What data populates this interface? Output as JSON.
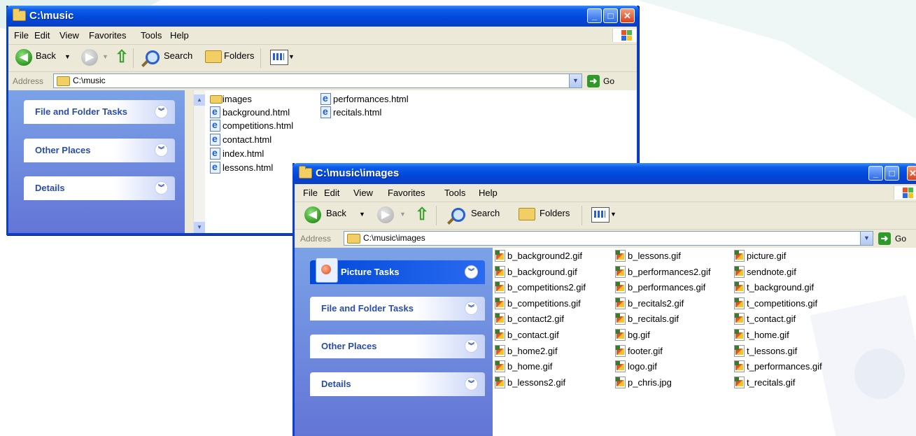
{
  "win1": {
    "title": "C:\\music",
    "menu": [
      "File",
      "Edit",
      "View",
      "Favorites",
      "Tools",
      "Help"
    ],
    "toolbar": {
      "back": "Back",
      "search": "Search",
      "folders": "Folders"
    },
    "address": {
      "label": "Address",
      "value": "C:\\music",
      "go": "Go"
    },
    "tasks": [
      "File and Folder Tasks",
      "Other Places",
      "Details"
    ],
    "files": [
      {
        "name": "images",
        "type": "folder"
      },
      {
        "name": "background.html",
        "type": "html"
      },
      {
        "name": "competitions.html",
        "type": "html"
      },
      {
        "name": "contact.html",
        "type": "html"
      },
      {
        "name": "index.html",
        "type": "html"
      },
      {
        "name": "lessons.html",
        "type": "html"
      },
      {
        "name": "performances.html",
        "type": "html"
      },
      {
        "name": "recitals.html",
        "type": "html"
      }
    ]
  },
  "win2": {
    "title": "C:\\music\\images",
    "menu": [
      "File",
      "Edit",
      "View",
      "Favorites",
      "Tools",
      "Help"
    ],
    "toolbar": {
      "back": "Back",
      "search": "Search",
      "folders": "Folders"
    },
    "address": {
      "label": "Address",
      "value": "C:\\music\\images",
      "go": "Go"
    },
    "tasks": [
      "Picture Tasks",
      "File and Folder Tasks",
      "Other Places",
      "Details"
    ],
    "files": [
      "b_background2.gif",
      "b_background.gif",
      "b_competitions2.gif",
      "b_competitions.gif",
      "b_contact2.gif",
      "b_contact.gif",
      "b_home2.gif",
      "b_home.gif",
      "b_lessons2.gif",
      "b_lessons.gif",
      "b_performances2.gif",
      "b_performances.gif",
      "b_recitals2.gif",
      "b_recitals.gif",
      "bg.gif",
      "footer.gif",
      "logo.gif",
      "p_chris.jpg",
      "picture.gif",
      "sendnote.gif",
      "t_background.gif",
      "t_competitions.gif",
      "t_contact.gif",
      "t_home.gif",
      "t_lessons.gif",
      "t_performances.gif",
      "t_recitals.gif"
    ]
  },
  "colors": {
    "titlebar": "#0a5be6",
    "taskpane": "#6f8fe0",
    "chrome": "#ece9d8"
  },
  "icons": [
    "folder-icon",
    "back-icon",
    "forward-icon",
    "up-icon",
    "search-icon",
    "folders-icon",
    "views-icon",
    "go-icon",
    "chevron-icon",
    "html-file-icon",
    "gif-file-icon"
  ]
}
